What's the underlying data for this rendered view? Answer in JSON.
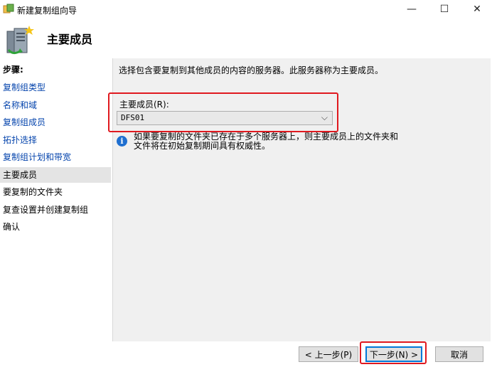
{
  "window": {
    "title": "新建复制组向导",
    "minimize": "—",
    "maximize": "☐",
    "close": "✕"
  },
  "header": {
    "title": "主要成员",
    "icon": "server-wizard-icon"
  },
  "sidebar": {
    "heading": "步骤:",
    "items": [
      {
        "label": "复制组类型",
        "state": "link"
      },
      {
        "label": "名称和域",
        "state": "link"
      },
      {
        "label": "复制组成员",
        "state": "link"
      },
      {
        "label": "拓扑选择",
        "state": "link"
      },
      {
        "label": "复制组计划和带宽",
        "state": "link"
      },
      {
        "label": "主要成员",
        "state": "current"
      },
      {
        "label": "要复制的文件夹",
        "state": "plain"
      },
      {
        "label": "复查设置并创建复制组",
        "state": "plain"
      },
      {
        "label": "确认",
        "state": "plain"
      }
    ]
  },
  "main": {
    "description": "选择包含要复制到其他成员的内容的服务器。此服务器称为主要成员。",
    "member_label": "主要成员(R):",
    "member_value": "DFS01",
    "info_line1": "如果要复制的文件夹已存在于多个服务器上，则主要成员上的文件夹和",
    "info_line2": "文件将在初始复制期间具有权威性。"
  },
  "buttons": {
    "prev": "< 上一步(P)",
    "next": "下一步(N) >",
    "cancel": "取消"
  },
  "colors": {
    "link": "#0645ad",
    "highlight": "#e0191f",
    "info": "#1f6fd0"
  }
}
